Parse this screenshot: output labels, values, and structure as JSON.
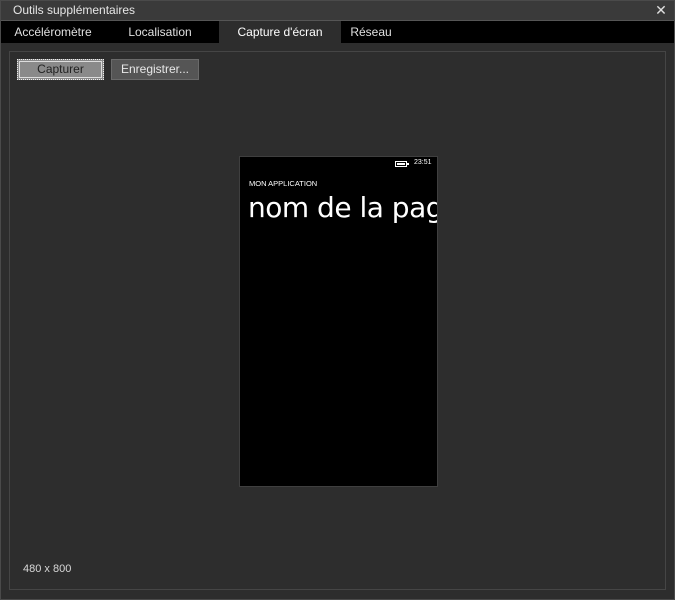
{
  "window": {
    "title": "Outils supplémentaires",
    "close_glyph": "✕"
  },
  "tabs": [
    {
      "label": "Accéléromètre",
      "active": false
    },
    {
      "label": "Localisation",
      "active": false
    },
    {
      "label": "Capture d'écran",
      "active": true
    },
    {
      "label": "Réseau",
      "active": false
    }
  ],
  "toolbar": {
    "capture_label": "Capturer",
    "save_label": "Enregistrer..."
  },
  "screenshot": {
    "status_time": "23:51",
    "battery_icon": "battery-icon",
    "app_title": "MON APPLICATION",
    "page_title": "nom de la page"
  },
  "resolution_label": "480 x 800",
  "colors": {
    "background": "#2d2d2d",
    "tab_bar": "#000000",
    "phone_screen": "#000000"
  }
}
